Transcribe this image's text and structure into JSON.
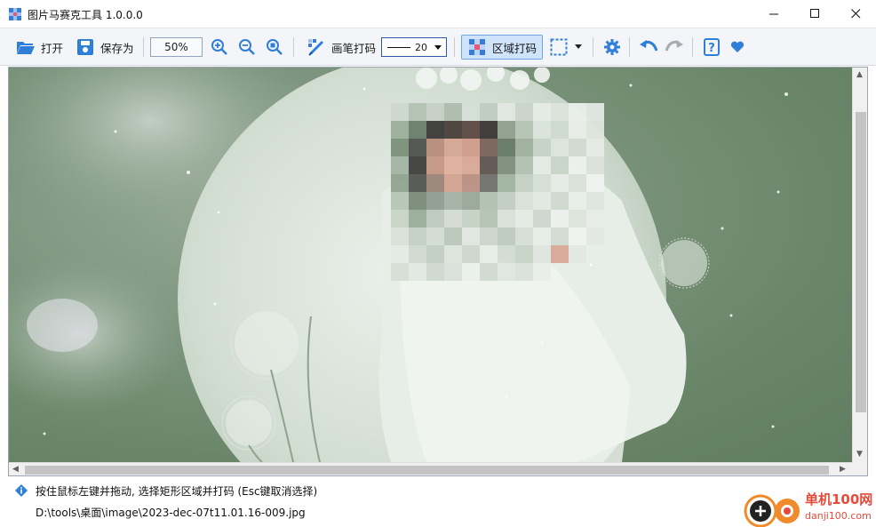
{
  "window": {
    "title": "图片马赛克工具 1.0.0.0",
    "minimize": "—",
    "maximize": "☐",
    "close": "✕"
  },
  "toolbar": {
    "open_label": "打开",
    "save_as_label": "保存为",
    "zoom_value": "50%",
    "brush_mosaic_label": "画笔打码",
    "brush_size": "20",
    "region_mosaic_label": "区域打码",
    "icons": [
      "open-folder-icon",
      "save-icon",
      "zoom-in-icon",
      "zoom-out-icon",
      "zoom-fit-icon",
      "brush-mosaic-icon",
      "region-mosaic-icon",
      "selection-rect-icon",
      "settings-icon",
      "undo-icon",
      "redo-icon",
      "help-icon",
      "heart-icon"
    ]
  },
  "colors": {
    "accent": "#2f7fd8",
    "toolbar_bg": "#f3f5f8",
    "active_bg": "#cfe4fb",
    "watermark": "#e64a3a"
  },
  "status": {
    "message": "按住鼠标左键并拖动, 选择矩形区域并打码 (Esc键取消选择)",
    "path": "D:\\tools\\桌面\\image\\2023-dec-07t11.01.16-009.jpg"
  },
  "watermark": {
    "line1": "单机100网",
    "line2": "danji100.com"
  }
}
